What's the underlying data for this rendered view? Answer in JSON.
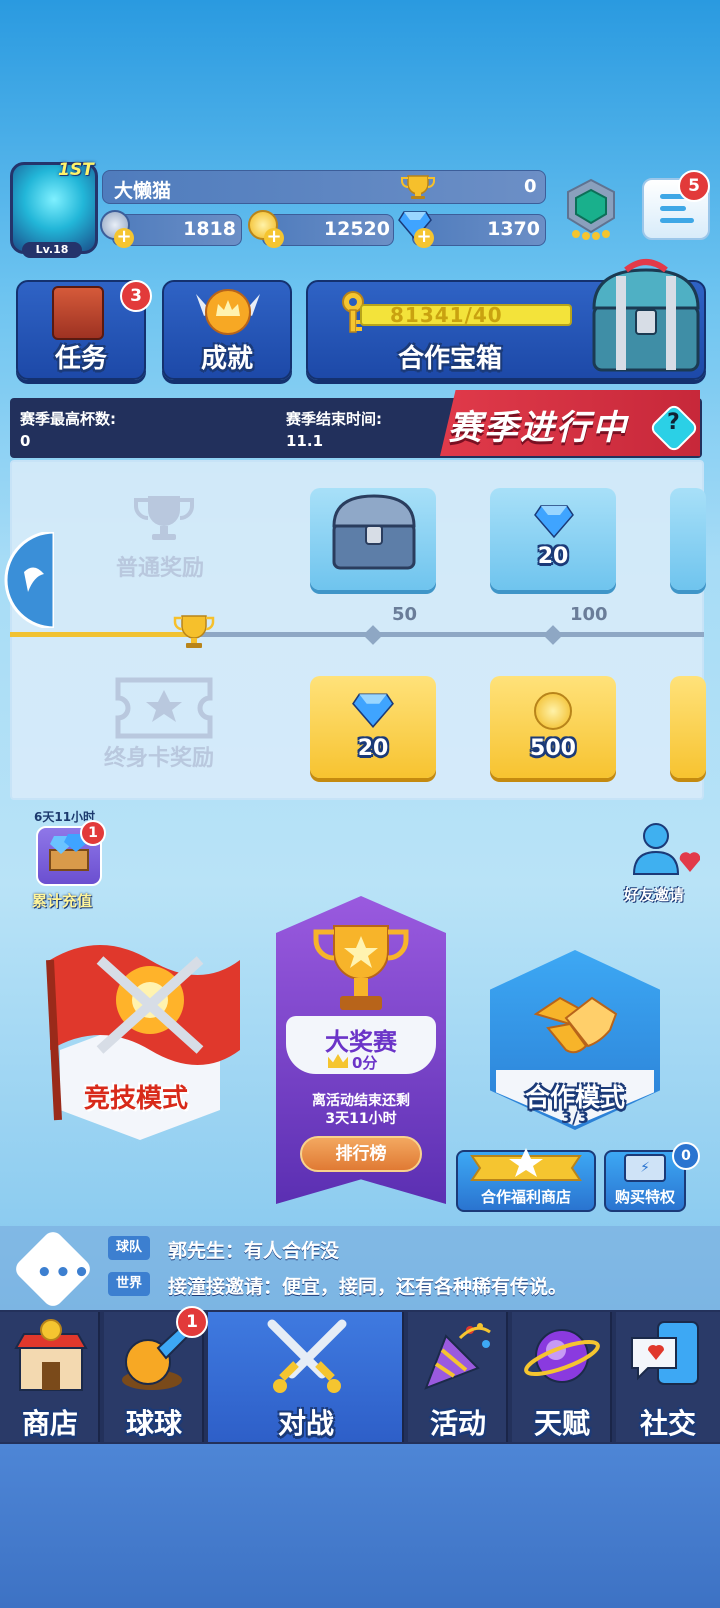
{
  "player": {
    "rank_label": "1ST",
    "level": "Lv.18",
    "name": "大懒猫",
    "trophies": "0"
  },
  "resources": {
    "silver": "1818",
    "gold": "12520",
    "gems": "1370"
  },
  "menu_badge": "5",
  "quick": {
    "tasks_label": "任务",
    "tasks_badge": "3",
    "achievement_label": "成就",
    "coop_chest_label": "合作宝箱",
    "coop_chest_progress": "81341/40"
  },
  "season": {
    "max_trophy_label": "赛季最高杯数:",
    "max_trophy_value": "0",
    "end_time_label": "赛季结束时间:",
    "end_time_value": "11.1",
    "banner": "赛季进行中",
    "help": "?",
    "normal_reward_label": "普通奖励",
    "lifetime_reward_label": "终身卡奖励",
    "milestones": [
      "50",
      "100"
    ],
    "normal_rewards": [
      "",
      "20"
    ],
    "lifetime_rewards": [
      "20",
      "500"
    ]
  },
  "events": {
    "recharge_timer": "6天11小时",
    "recharge_label": "累计充值",
    "recharge_badge": "1",
    "invite_label": "好友邀请"
  },
  "modes": {
    "competitive": "竞技模式",
    "grand_prix_title": "大奖赛",
    "grand_prix_score": "0分",
    "grand_prix_countdown_1": "离活动结束还剩",
    "grand_prix_countdown_2": "3天11小时",
    "leaderboard": "排行榜",
    "coop": "合作模式",
    "coop_count": "3/3",
    "coop_shop": "合作福利商店",
    "buy_privilege": "购买特权",
    "buy_privilege_badge": "0"
  },
  "chat": {
    "line1_tag": "球队",
    "line1_text": "郭先生：有人合作没",
    "line2_tag": "世界",
    "line2_text": "接潼接邀请：便宜，接同，还有各种稀有传说。"
  },
  "nav": {
    "items": [
      {
        "label": "商店"
      },
      {
        "label": "球球",
        "badge": "1"
      },
      {
        "label": "对战"
      },
      {
        "label": "活动"
      },
      {
        "label": "天赋"
      },
      {
        "label": "社交"
      }
    ]
  },
  "colors": {
    "accent_blue": "#2e5fc8",
    "badge_red": "#e23a3a",
    "banner_red": "#e03a4a",
    "gold": "#f7c330"
  }
}
